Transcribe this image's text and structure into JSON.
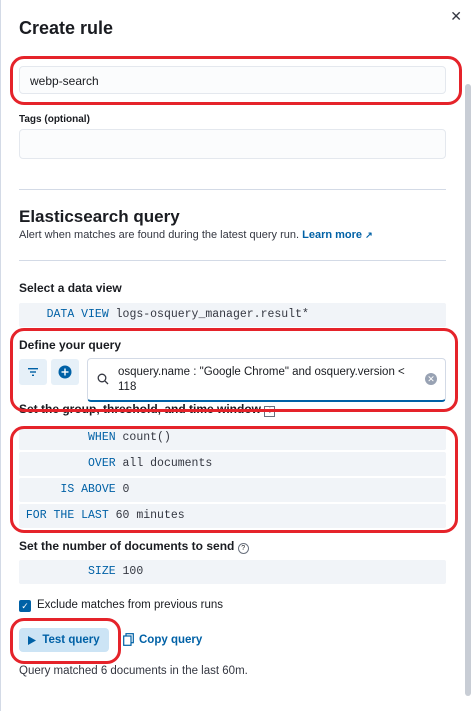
{
  "flyout": {
    "title": "Create rule"
  },
  "rule": {
    "name_value": "webp-search",
    "tags_label": "Tags (optional)",
    "tags_value": ""
  },
  "query_section": {
    "title": "Elasticsearch query",
    "description": "Alert when matches are found during the latest query run.",
    "learn_more": "Learn more",
    "data_view_label": "Select a data view",
    "data_view_keyword": "DATA VIEW",
    "data_view_value": "logs-osquery_manager.result*",
    "define_query_label": "Define your query",
    "query_text": "osquery.name : \"Google Chrome\" and osquery.version < 118",
    "group_label": "Set the group, threshold, and time window",
    "when_keyword": "WHEN",
    "when_value": "count()",
    "over_keyword": "OVER",
    "over_value": "all documents",
    "is_above_keyword": "IS ABOVE",
    "is_above_value": "0",
    "for_the_last_keyword": "FOR THE LAST",
    "for_the_last_value": "60 minutes",
    "size_label": "Set the number of documents to send",
    "size_keyword": "SIZE",
    "size_value": "100",
    "exclude_label": "Exclude matches from previous runs",
    "exclude_checked": true,
    "test_query": "Test query",
    "copy_query": "Copy query",
    "result": "Query matched 6 documents in the last 60m."
  },
  "colors": {
    "accent": "#0061a6",
    "highlight": "#e5232a"
  },
  "icons": [
    "close-icon",
    "filter-icon",
    "plus-circle-icon",
    "search-icon",
    "clear-icon",
    "info-icon",
    "help-icon",
    "external-link-icon",
    "play-icon",
    "copy-icon",
    "checkbox-check-icon"
  ]
}
